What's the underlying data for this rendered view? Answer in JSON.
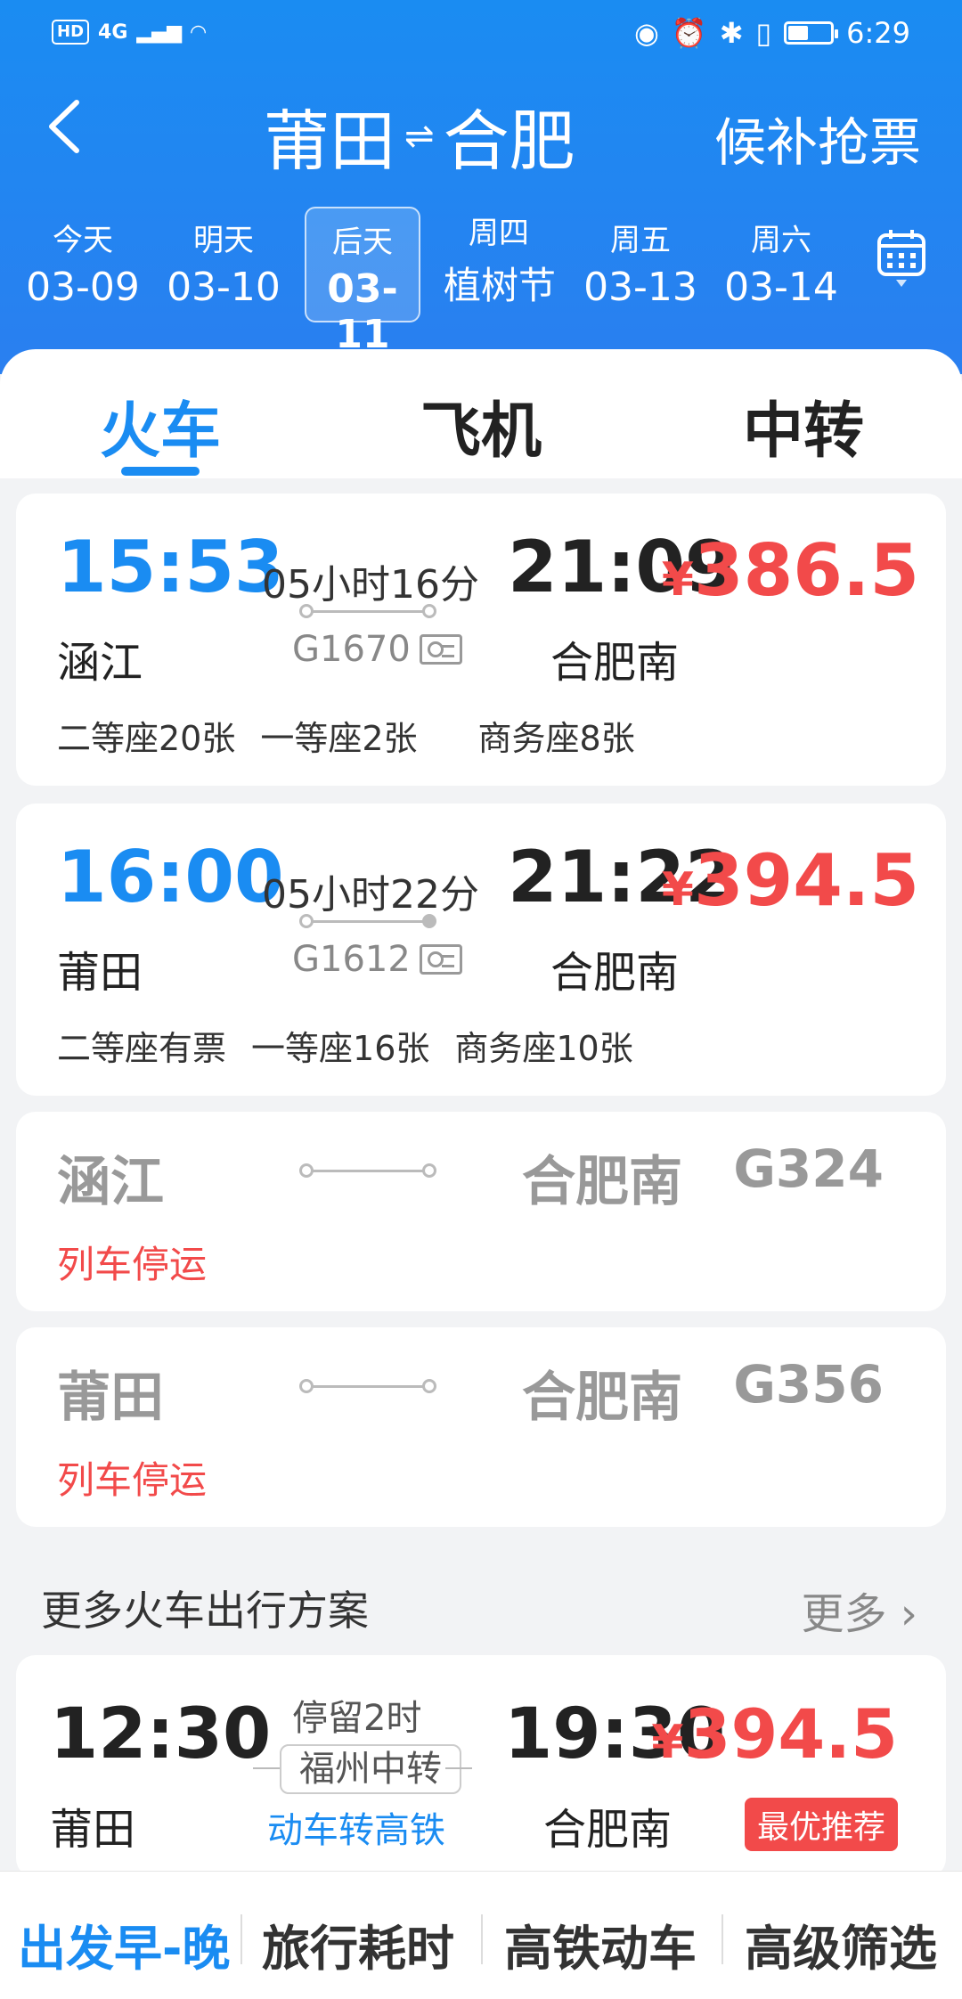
{
  "status_bar": {
    "left": [
      "HD",
      "4G"
    ],
    "time": "6:29"
  },
  "nav": {
    "back_icon": "chevron-left-icon",
    "from": "莆田",
    "swap_icon": "swap-arrows-icon",
    "to": "合肥",
    "waitlist_label": "候补抢票"
  },
  "dates": [
    {
      "weekday": "今天",
      "date": "03-09"
    },
    {
      "weekday": "明天",
      "date": "03-10"
    },
    {
      "weekday": "后天",
      "date": "03-11",
      "selected": true
    },
    {
      "weekday": "周四",
      "date": "植树节"
    },
    {
      "weekday": "周五",
      "date": "03-13"
    },
    {
      "weekday": "周六",
      "date": "03-14"
    }
  ],
  "calendar_icon": "calendar-icon",
  "tabs": [
    "火车",
    "飞机",
    "中转"
  ],
  "trains": [
    {
      "dep_time": "15:53",
      "dep_station": "涵江",
      "duration": "05小时16分",
      "train_no": "G1670",
      "arr_time": "21:09",
      "arr_station": "合肥南",
      "price_symbol": "¥",
      "price": "386.5",
      "seats": [
        "二等座20张",
        "一等座2张",
        "商务座8张"
      ]
    },
    {
      "dep_time": "16:00",
      "dep_station": "莆田",
      "duration": "05小时22分",
      "train_no": "G1612",
      "arr_time": "21:22",
      "arr_station": "合肥南",
      "price_symbol": "¥",
      "price": "394.5",
      "seats": [
        "二等座有票",
        "一等座16张",
        "商务座10张"
      ]
    }
  ],
  "stopped_trains": [
    {
      "dep_station": "涵江",
      "arr_station": "合肥南",
      "train_no": "G324",
      "status": "列车停运"
    },
    {
      "dep_station": "莆田",
      "arr_station": "合肥南",
      "train_no": "G356",
      "status": "列车停运"
    }
  ],
  "more_plans": {
    "title": "更多火车出行方案",
    "more_label": "更多",
    "plan": {
      "dep_time": "12:30",
      "dep_station": "莆田",
      "stay": "停留2时",
      "transfer": "福州中转",
      "mode": "动车转高铁",
      "arr_time": "19:30",
      "arr_station": "合肥南",
      "price_symbol": "¥",
      "price": "394.5",
      "badge": "最优推荐"
    }
  },
  "filters": [
    "出发早-晚",
    "旅行耗时",
    "高铁动车",
    "高级筛选"
  ],
  "colors": {
    "primary": "#1a8cf2",
    "price": "#f24a4a"
  }
}
